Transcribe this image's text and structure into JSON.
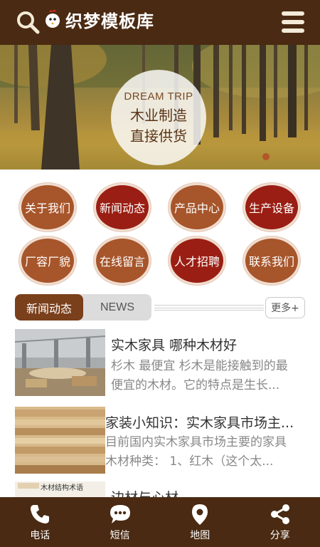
{
  "header": {
    "logo_text": "织梦模板库",
    "search_icon": "search-icon",
    "menu_icon": "hamburger-menu-icon"
  },
  "banner": {
    "en_text": "DREAM TRIP",
    "line1": "木业制造",
    "line2": "直接供货"
  },
  "nav": {
    "items": [
      {
        "label": "关于我们",
        "color": "#a7552a"
      },
      {
        "label": "新闻动态",
        "color": "#9a1e13"
      },
      {
        "label": "产品中心",
        "color": "#a7552a"
      },
      {
        "label": "生产设备",
        "color": "#9a1e13"
      },
      {
        "label": "厂容厂貌",
        "color": "#a7552a"
      },
      {
        "label": "在线留言",
        "color": "#a7552a"
      },
      {
        "label": "人才招聘",
        "color": "#9a1e13"
      },
      {
        "label": "联系我们",
        "color": "#a7552a"
      }
    ]
  },
  "news": {
    "tab_active": "新闻动态",
    "tab_en": "NEWS",
    "more": "更多+",
    "items": [
      {
        "title": "实木家具 哪种木材好",
        "desc": "杉木 最便宜 杉木是能接触到的最便宜的木材。它的特点是生长..."
      },
      {
        "title": "家装小知识：实木家具市场主...",
        "desc": "目前国内实木家具市场主要的家具木材种类： 1、红木（这个太..."
      },
      {
        "title": "边材与心材",
        "desc": ""
      }
    ],
    "thumb3_caption": "木材结构术语"
  },
  "footer": {
    "items": [
      {
        "label": "电话",
        "icon": "phone-icon"
      },
      {
        "label": "短信",
        "icon": "sms-icon"
      },
      {
        "label": "地图",
        "icon": "map-pin-icon"
      },
      {
        "label": "分享",
        "icon": "share-icon"
      }
    ]
  },
  "colors": {
    "header_bg": "#4a2a12",
    "accent_brown": "#a7552a",
    "accent_red": "#9a1e13",
    "tab_active_bg": "#7a3f1b"
  }
}
